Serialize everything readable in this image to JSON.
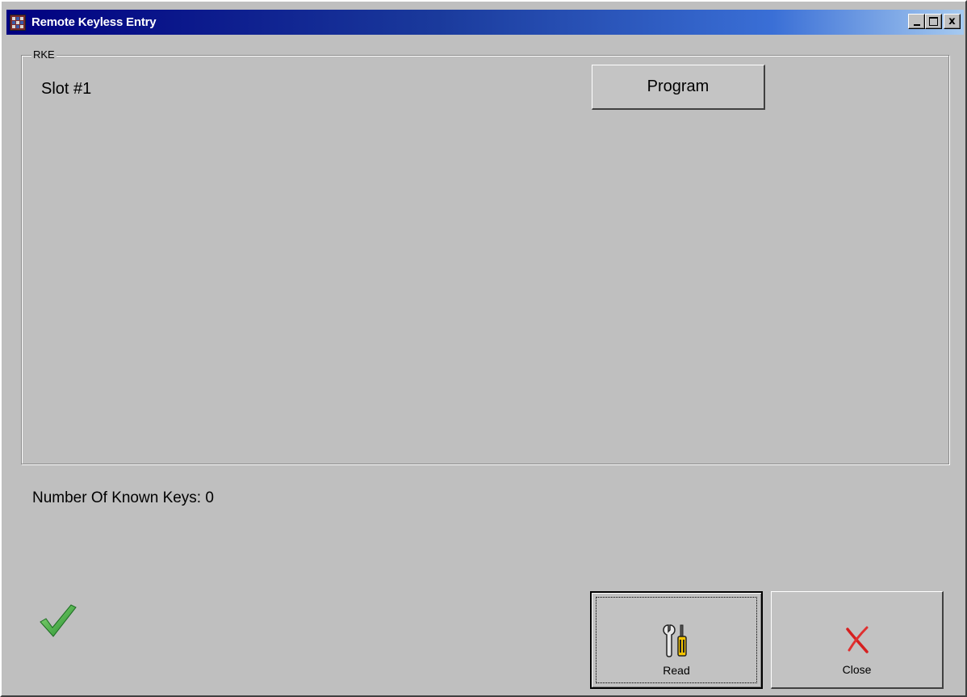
{
  "window": {
    "title": "Remote Keyless Entry",
    "controls": {
      "minimize_icon": "minimize-icon",
      "maximize_icon": "maximize-icon",
      "close_glyph": "x"
    }
  },
  "rke_group": {
    "label": "RKE",
    "slot_label": "Slot #1",
    "program_button": "Program"
  },
  "status": {
    "known_keys_text": "Number Of Known Keys: 0",
    "status_icon": "checkmark-icon",
    "status_color": "#3fa83f"
  },
  "actions": {
    "read": {
      "label": "Read",
      "icon": "tools-icon"
    },
    "close": {
      "label": "Close",
      "icon": "close-x-icon",
      "color": "#d62020"
    }
  }
}
